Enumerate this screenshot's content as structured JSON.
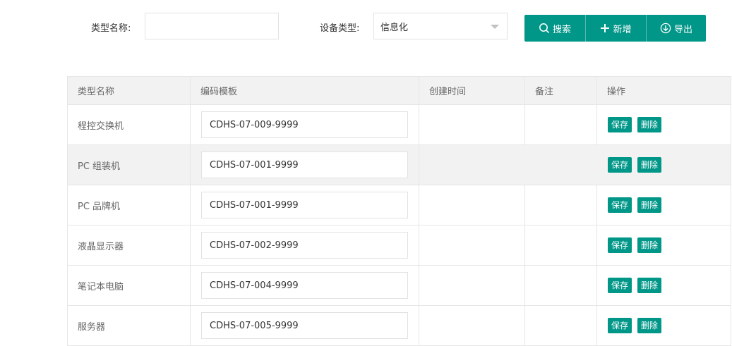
{
  "search": {
    "type_name_label": "类型名称:",
    "type_name_value": "",
    "device_type_label": "设备类型:",
    "device_type_selected": "信息化"
  },
  "toolbar": {
    "search_label": "搜索",
    "add_label": "新增",
    "export_label": "导出"
  },
  "table": {
    "headers": [
      "类型名称",
      "编码模板",
      "创建时间",
      "备注",
      "操作"
    ],
    "rows": [
      {
        "name": "程控交换机",
        "code": "CDHS-07-009-9999",
        "created": "",
        "note": ""
      },
      {
        "name": "PC 组装机",
        "code": "CDHS-07-001-9999",
        "created": "",
        "note": ""
      },
      {
        "name": "PC 品牌机",
        "code": "CDHS-07-001-9999",
        "created": "",
        "note": ""
      },
      {
        "name": "液晶显示器",
        "code": "CDHS-07-002-9999",
        "created": "",
        "note": ""
      },
      {
        "name": "笔记本电脑",
        "code": "CDHS-07-004-9999",
        "created": "",
        "note": ""
      },
      {
        "name": "服务器",
        "code": "CDHS-07-005-9999",
        "created": "",
        "note": ""
      }
    ],
    "save_label": "保存",
    "delete_label": "删除"
  },
  "colors": {
    "primary": "#009688",
    "header_bg": "#f2f2f2",
    "border": "#e6e6e6"
  },
  "icons": [
    "search-icon",
    "plus-icon",
    "download-icon",
    "chevron-down-icon"
  ]
}
